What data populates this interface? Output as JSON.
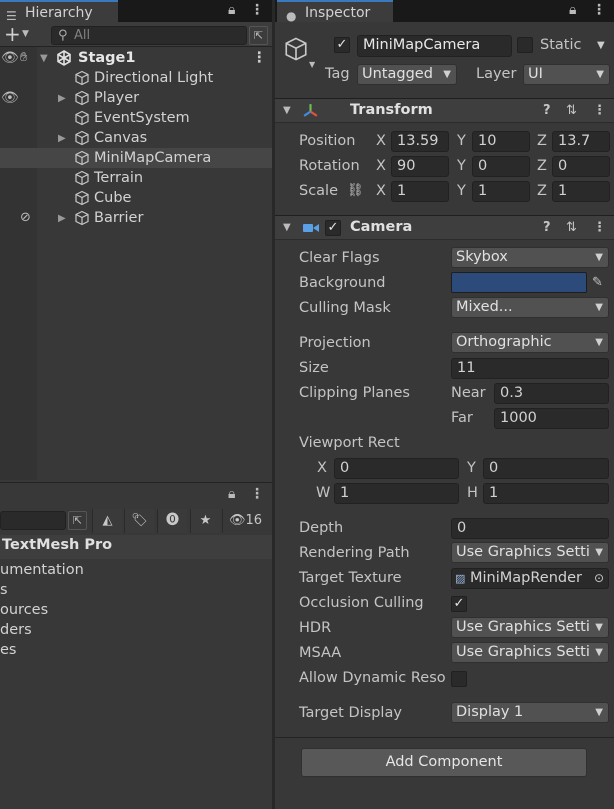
{
  "hierarchy": {
    "tab_label": "Hierarchy",
    "add_label": "+",
    "search_placeholder": "All",
    "scene_name": "Stage1",
    "items": [
      {
        "label": "Directional Light"
      },
      {
        "label": "Player"
      },
      {
        "label": "EventSystem"
      },
      {
        "label": "Canvas"
      },
      {
        "label": "MiniMapCamera"
      },
      {
        "label": "Terrain"
      },
      {
        "label": "Cube"
      },
      {
        "label": "Barrier"
      }
    ]
  },
  "project": {
    "visible_count": "16",
    "package_header": "TextMesh Pro",
    "entries": [
      "umentation",
      "s",
      "ources",
      "ders",
      "es"
    ]
  },
  "inspector": {
    "tab_label": "Inspector",
    "object_name": "MiniMapCamera",
    "static_label": "Static",
    "tag_label": "Tag",
    "tag_value": "Untagged",
    "layer_label": "Layer",
    "layer_value": "UI",
    "transform": {
      "title": "Transform",
      "position_label": "Position",
      "rotation_label": "Rotation",
      "scale_label": "Scale",
      "x_label": "X",
      "y_label": "Y",
      "z_label": "Z",
      "position": {
        "x": "13.59",
        "y": "10",
        "z": "13.7"
      },
      "rotation": {
        "x": "90",
        "y": "0",
        "z": "0"
      },
      "scale": {
        "x": "1",
        "y": "1",
        "z": "1"
      }
    },
    "camera": {
      "title": "Camera",
      "clear_flags_label": "Clear Flags",
      "clear_flags_value": "Skybox",
      "background_label": "Background",
      "background_color": "#2c4a7a",
      "culling_mask_label": "Culling Mask",
      "culling_mask_value": "Mixed...",
      "projection_label": "Projection",
      "projection_value": "Orthographic",
      "size_label": "Size",
      "size_value": "11",
      "clipping_label": "Clipping Planes",
      "near_label": "Near",
      "near_value": "0.3",
      "far_label": "Far",
      "far_value": "1000",
      "viewport_label": "Viewport Rect",
      "vx_label": "X",
      "vx_value": "0",
      "vy_label": "Y",
      "vy_value": "0",
      "vw_label": "W",
      "vw_value": "1",
      "vh_label": "H",
      "vh_value": "1",
      "depth_label": "Depth",
      "depth_value": "0",
      "rendering_path_label": "Rendering Path",
      "rendering_path_value": "Use Graphics Setti",
      "target_texture_label": "Target Texture",
      "target_texture_value": "MiniMapRender",
      "occlusion_label": "Occlusion Culling",
      "hdr_label": "HDR",
      "hdr_value": "Use Graphics Setti",
      "msaa_label": "MSAA",
      "msaa_value": "Use Graphics Setti",
      "dynres_label": "Allow Dynamic Reso",
      "target_display_label": "Target Display",
      "target_display_value": "Display 1"
    },
    "add_component_label": "Add Component"
  },
  "colors": {
    "accent": "#3a79bb",
    "panel": "#383838",
    "field": "#2a2a2a"
  }
}
